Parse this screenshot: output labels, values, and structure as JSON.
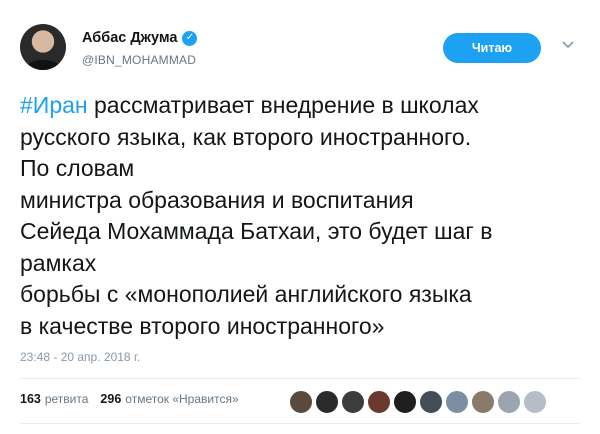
{
  "user": {
    "display_name": "Аббас Джума",
    "handle": "@IBN_MOHAMMAD",
    "verified_mark": "✓"
  },
  "follow_button": {
    "label": "Читаю"
  },
  "tweet": {
    "hashtag": "#Иран",
    "line_1_rest": " рассматривает внедрение в школах",
    "lines": [
      "русского языка, как второго иностранного.",
      "По словам",
      "министра образования и воспитания",
      "Сейеда Мохаммада Батхаи, это будет шаг в",
      "рамках",
      "борьбы с «монополией английского языка",
      "в качестве второго иностранного»"
    ],
    "timestamp": "23:48 - 20 апр. 2018 г."
  },
  "stats": {
    "retweets_count": "163",
    "retweets_label": "ретвита",
    "likes_count": "296",
    "likes_label": "отметок «Нравится»"
  },
  "likers": [
    {
      "color": "#5a4a3e"
    },
    {
      "color": "#2b2b2b"
    },
    {
      "color": "#3c3c3c"
    },
    {
      "color": "#6b3a2f"
    },
    {
      "color": "#1e1e1e"
    },
    {
      "color": "#444c55"
    },
    {
      "color": "#7a8fa3"
    },
    {
      "color": "#8a7a6a"
    },
    {
      "color": "#9aa5b1"
    },
    {
      "color": "#b5bec8"
    }
  ],
  "colors": {
    "accent": "#1da1f2",
    "text": "#14171a",
    "muted": "#657786"
  }
}
